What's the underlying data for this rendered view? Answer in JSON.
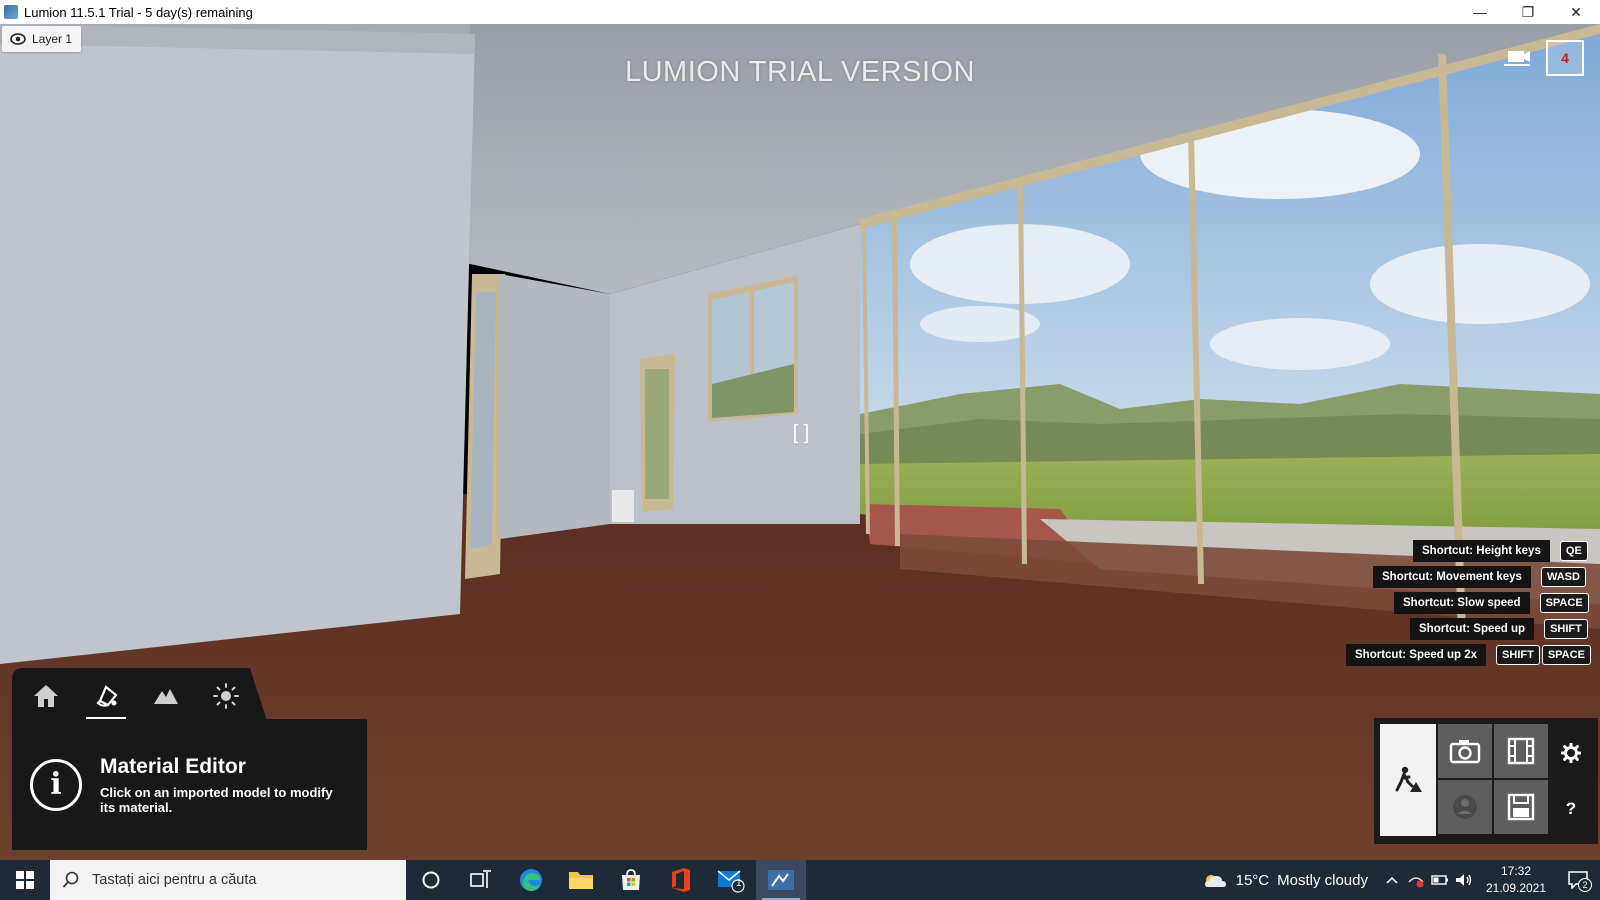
{
  "window": {
    "title": "Lumion 11.5.1 Trial - 5 day(s) remaining",
    "controls": {
      "minimize": "—",
      "restore": "❐",
      "close": "✕"
    }
  },
  "viewport": {
    "layer_label": "Layer 1",
    "trial_banner": "LUMION TRIAL VERSION",
    "notification_count": "4",
    "crosshair": "[ ]"
  },
  "shortcuts": [
    {
      "label": "Shortcut: Height keys",
      "keys": [
        "QE"
      ]
    },
    {
      "label": "Shortcut: Movement keys",
      "keys": [
        "WASD"
      ]
    },
    {
      "label": "Shortcut: Slow speed",
      "keys": [
        "SPACE"
      ]
    },
    {
      "label": "Shortcut: Speed up",
      "keys": [
        "SHIFT"
      ]
    },
    {
      "label": "Shortcut: Speed up 2x",
      "keys": [
        "SHIFT",
        "SPACE"
      ]
    }
  ],
  "mode_tabs": {
    "items": [
      "home-icon",
      "material-icon",
      "landscape-icon",
      "weather-sun-icon"
    ],
    "active": "material-icon"
  },
  "info_panel": {
    "title": "Material Editor",
    "description": "Click on an imported model to modify its material.",
    "icon": "i"
  },
  "right_tools": {
    "build_mode_icon": "build-mode-icon",
    "photo_icon": "camera-icon",
    "movie_icon": "film-icon",
    "panorama_icon": "panorama-icon",
    "save_icon": "save-icon",
    "settings_icon": "gear-icon",
    "help_label": "?"
  },
  "taskbar": {
    "search_placeholder": "Tastați aici pentru a căuta",
    "weather_temp": "15°C",
    "weather_desc": "Mostly cloudy",
    "time": "17:32",
    "date": "21.09.2021",
    "notification_count": "2",
    "mail_badge": "1",
    "active_app": "lumion"
  },
  "colors": {
    "floor": "#6a3a2a",
    "panel_bg": "#181818",
    "taskbar_bg": "#1f2a38",
    "badge_red": "#d01818"
  }
}
